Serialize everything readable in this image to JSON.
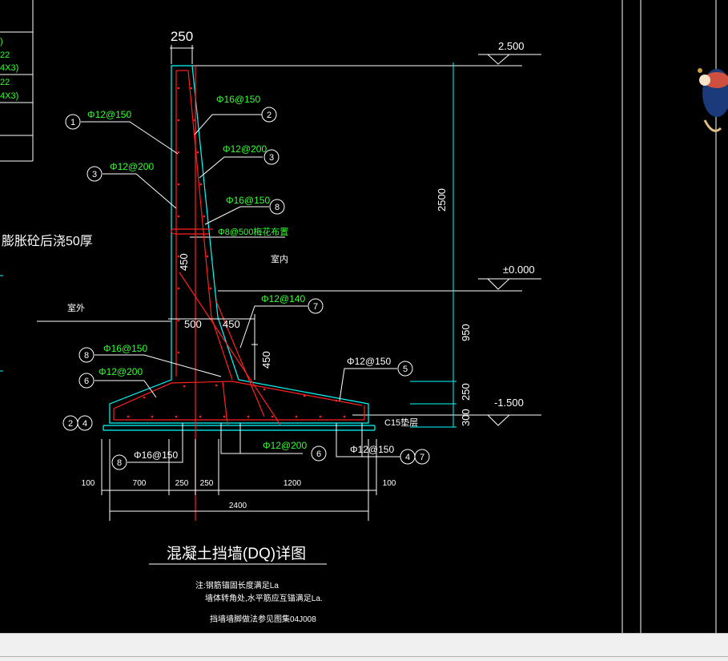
{
  "drawing": {
    "title": "混凝土挡墙(DQ)详图",
    "notes": [
      "注:钢筋锚固长度满足La",
      "墙体转角处,水平筋应互锚满足La.",
      "挡墙墙脚做法参见图集04J008"
    ],
    "side_note": "膨胀砼后浇50厚",
    "label_indoor": "室内",
    "label_outdoor": "室外",
    "label_cushion": "C15垫层",
    "table_fragments": [
      ")",
      "22",
      "4X3)",
      "22",
      "4X3)"
    ],
    "elevations": {
      "top": "2.500",
      "zero": "±0.000",
      "bottom": "-1.500"
    },
    "dimensions": {
      "top_width": "250",
      "wall_height": "2500",
      "lower_height": "950",
      "base_step": "250",
      "base_thickness": "300",
      "haunch_h": "450",
      "haunch_w1": "500",
      "haunch_w2": "450",
      "haunch_v": "450",
      "bottom": [
        "100",
        "700",
        "250",
        "250",
        "1200",
        "100"
      ],
      "total": "2400"
    },
    "rebars": [
      {
        "num": "1",
        "label": "Φ12@150"
      },
      {
        "num": "2",
        "label": "Φ16@150"
      },
      {
        "num": "3",
        "label": "Φ12@200"
      },
      {
        "num": "3",
        "label": "Φ12@200"
      },
      {
        "num": "8",
        "label": "Φ16@150"
      },
      {
        "num": "",
        "label": "Φ8@500梅花布置"
      },
      {
        "num": "7",
        "label": "Φ12@140"
      },
      {
        "num": "8",
        "label": "Φ16@150"
      },
      {
        "num": "6",
        "label": "Φ12@200"
      },
      {
        "num": "5",
        "label": "Φ12@150"
      },
      {
        "num": "8",
        "label": "Φ16@150"
      },
      {
        "num": "6",
        "label": "Φ12@200"
      },
      {
        "num": "4",
        "label": "Φ12@150"
      }
    ],
    "circle_labels": {
      "left_pair": [
        "2",
        "4"
      ],
      "right_pair": [
        "4",
        "7"
      ]
    },
    "colors": {
      "background": "#000000",
      "concrete": "#00ffff",
      "rebar": "#ff2020",
      "rebar_text": "#33ff33",
      "line": "#ffffff",
      "status_bar": "#f0f0f0"
    }
  }
}
